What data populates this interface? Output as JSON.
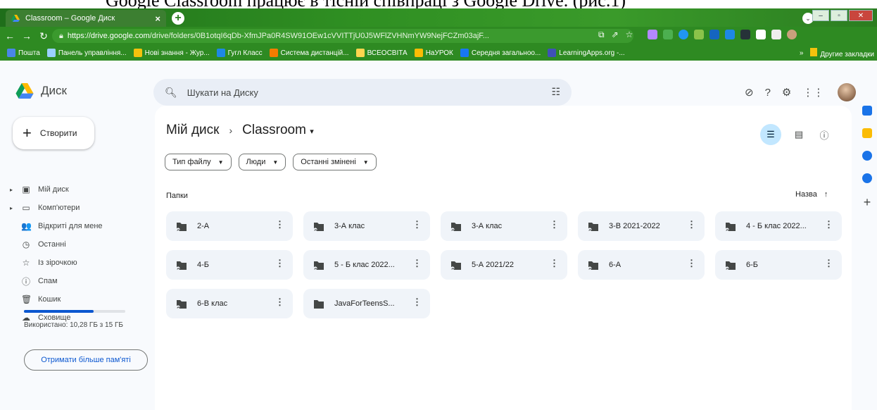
{
  "caption": "Google Classroom працює в тісній співпраці з Google Drive. (рис.1)",
  "browser": {
    "tab_title": "Classroom – Google Диск",
    "tab_close": "×",
    "new_tab": "+",
    "url_host": "https://drive.google.com",
    "url_path": "/drive/folders/0B1otqI6qDb-XfmJPa0R4SW91OEw1cVVITTjU0J5WFlZVHNmYW9NejFCZm03ajF...",
    "bookmarks": [
      {
        "label": "Пошта",
        "color": "#4a86e8"
      },
      {
        "label": "Панель управління...",
        "color": "#9bd1ff"
      },
      {
        "label": "Нові знання - Жур...",
        "color": "#f4c20d"
      },
      {
        "label": "Гугл Класс",
        "color": "#1e88e5"
      },
      {
        "label": "Система дистанцій...",
        "color": "#f57c00"
      },
      {
        "label": "ВСЕОСВІТА",
        "color": "#ffd54f"
      },
      {
        "label": "НаУРОК",
        "color": "#fbbc04"
      },
      {
        "label": "Середня загальноо...",
        "color": "#1877f2"
      },
      {
        "label": "LearningApps.org -...",
        "color": "#3f51b5"
      }
    ],
    "bookmarks_more": "»",
    "other_bookmarks": "Другие закладки"
  },
  "drive": {
    "logo_text": "Диск",
    "search_placeholder": "Шукати на Диску",
    "create_label": "Створити",
    "sidebar": [
      {
        "label": "Мій диск",
        "icon": "drive-icon",
        "glyph": "▣",
        "arrow": true
      },
      {
        "label": "Комп'ютери",
        "icon": "computer-icon",
        "glyph": "▭",
        "arrow": true
      },
      {
        "label": "Відкриті для мене",
        "icon": "shared-icon",
        "glyph": "👥",
        "arrow": false
      },
      {
        "label": "Останні",
        "icon": "clock-icon",
        "glyph": "◷",
        "arrow": false
      },
      {
        "label": "Із зірочкою",
        "icon": "star-icon",
        "glyph": "☆",
        "arrow": false
      },
      {
        "label": "Спам",
        "icon": "spam-icon",
        "glyph": "ⓘ",
        "arrow": false
      },
      {
        "label": "Кошик",
        "icon": "trash-icon",
        "glyph": "🗑",
        "arrow": false
      },
      {
        "label": "Сховище",
        "icon": "cloud-icon",
        "glyph": "☁",
        "arrow": false
      }
    ],
    "storage_used_fraction": 0.685,
    "storage_text": "Використано: 10,28 ГБ з 15 ГБ",
    "get_more_storage": "Отримати більше пам'яті",
    "breadcrumb_root": "Мій диск",
    "breadcrumb_sep": "›",
    "breadcrumb_current": "Classroom",
    "filters": [
      "Тип файлу",
      "Люди",
      "Останні змінені"
    ],
    "folders_heading": "Папки",
    "sort_label": "Назва",
    "sort_arrow": "↑",
    "folders": [
      {
        "name": "2-А",
        "shared": true
      },
      {
        "name": "3-А клас",
        "shared": true
      },
      {
        "name": "3-А клас",
        "shared": true
      },
      {
        "name": "3-В 2021-2022",
        "shared": true
      },
      {
        "name": "4 - Б клас 2022...",
        "shared": true
      },
      {
        "name": "4-Б",
        "shared": true
      },
      {
        "name": "5 - Б клас 2022...",
        "shared": true
      },
      {
        "name": "5-А 2021/22",
        "shared": true
      },
      {
        "name": "6-А",
        "shared": true
      },
      {
        "name": "6-Б",
        "shared": true
      },
      {
        "name": "6-В клас",
        "shared": true
      },
      {
        "name": "JavaForTeensS...",
        "shared": false
      }
    ],
    "side_panel_colors": [
      "#1a73e8",
      "#fbbc04",
      "#1a73e8",
      "#1a73e8"
    ],
    "side_panel_add": "+"
  }
}
